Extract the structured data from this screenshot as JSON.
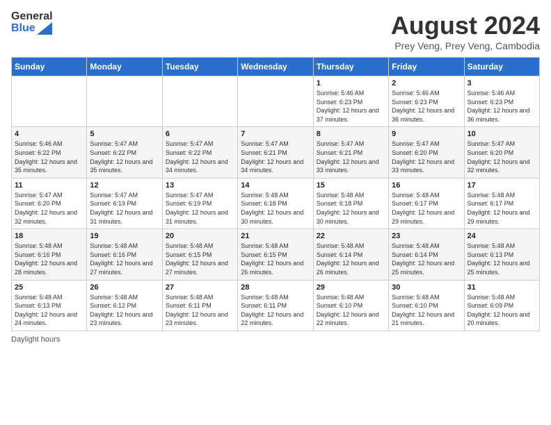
{
  "header": {
    "logo_general": "General",
    "logo_blue": "Blue",
    "title": "August 2024",
    "subtitle": "Prey Veng, Prey Veng, Cambodia"
  },
  "calendar": {
    "days_of_week": [
      "Sunday",
      "Monday",
      "Tuesday",
      "Wednesday",
      "Thursday",
      "Friday",
      "Saturday"
    ],
    "weeks": [
      [
        {
          "day": "",
          "info": ""
        },
        {
          "day": "",
          "info": ""
        },
        {
          "day": "",
          "info": ""
        },
        {
          "day": "",
          "info": ""
        },
        {
          "day": "1",
          "info": "Sunrise: 5:46 AM\nSunset: 6:23 PM\nDaylight: 12 hours and 37 minutes."
        },
        {
          "day": "2",
          "info": "Sunrise: 5:46 AM\nSunset: 6:23 PM\nDaylight: 12 hours and 36 minutes."
        },
        {
          "day": "3",
          "info": "Sunrise: 5:46 AM\nSunset: 6:23 PM\nDaylight: 12 hours and 36 minutes."
        }
      ],
      [
        {
          "day": "4",
          "info": "Sunrise: 5:46 AM\nSunset: 6:22 PM\nDaylight: 12 hours and 35 minutes."
        },
        {
          "day": "5",
          "info": "Sunrise: 5:47 AM\nSunset: 6:22 PM\nDaylight: 12 hours and 35 minutes."
        },
        {
          "day": "6",
          "info": "Sunrise: 5:47 AM\nSunset: 6:22 PM\nDaylight: 12 hours and 34 minutes."
        },
        {
          "day": "7",
          "info": "Sunrise: 5:47 AM\nSunset: 6:21 PM\nDaylight: 12 hours and 34 minutes."
        },
        {
          "day": "8",
          "info": "Sunrise: 5:47 AM\nSunset: 6:21 PM\nDaylight: 12 hours and 33 minutes."
        },
        {
          "day": "9",
          "info": "Sunrise: 5:47 AM\nSunset: 6:20 PM\nDaylight: 12 hours and 33 minutes."
        },
        {
          "day": "10",
          "info": "Sunrise: 5:47 AM\nSunset: 6:20 PM\nDaylight: 12 hours and 32 minutes."
        }
      ],
      [
        {
          "day": "11",
          "info": "Sunrise: 5:47 AM\nSunset: 6:20 PM\nDaylight: 12 hours and 32 minutes."
        },
        {
          "day": "12",
          "info": "Sunrise: 5:47 AM\nSunset: 6:19 PM\nDaylight: 12 hours and 31 minutes."
        },
        {
          "day": "13",
          "info": "Sunrise: 5:47 AM\nSunset: 6:19 PM\nDaylight: 12 hours and 31 minutes."
        },
        {
          "day": "14",
          "info": "Sunrise: 5:48 AM\nSunset: 6:18 PM\nDaylight: 12 hours and 30 minutes."
        },
        {
          "day": "15",
          "info": "Sunrise: 5:48 AM\nSunset: 6:18 PM\nDaylight: 12 hours and 30 minutes."
        },
        {
          "day": "16",
          "info": "Sunrise: 5:48 AM\nSunset: 6:17 PM\nDaylight: 12 hours and 29 minutes."
        },
        {
          "day": "17",
          "info": "Sunrise: 5:48 AM\nSunset: 6:17 PM\nDaylight: 12 hours and 29 minutes."
        }
      ],
      [
        {
          "day": "18",
          "info": "Sunrise: 5:48 AM\nSunset: 6:16 PM\nDaylight: 12 hours and 28 minutes."
        },
        {
          "day": "19",
          "info": "Sunrise: 5:48 AM\nSunset: 6:16 PM\nDaylight: 12 hours and 27 minutes."
        },
        {
          "day": "20",
          "info": "Sunrise: 5:48 AM\nSunset: 6:15 PM\nDaylight: 12 hours and 27 minutes."
        },
        {
          "day": "21",
          "info": "Sunrise: 5:48 AM\nSunset: 6:15 PM\nDaylight: 12 hours and 26 minutes."
        },
        {
          "day": "22",
          "info": "Sunrise: 5:48 AM\nSunset: 6:14 PM\nDaylight: 12 hours and 26 minutes."
        },
        {
          "day": "23",
          "info": "Sunrise: 5:48 AM\nSunset: 6:14 PM\nDaylight: 12 hours and 25 minutes."
        },
        {
          "day": "24",
          "info": "Sunrise: 5:48 AM\nSunset: 6:13 PM\nDaylight: 12 hours and 25 minutes."
        }
      ],
      [
        {
          "day": "25",
          "info": "Sunrise: 5:48 AM\nSunset: 6:13 PM\nDaylight: 12 hours and 24 minutes."
        },
        {
          "day": "26",
          "info": "Sunrise: 5:48 AM\nSunset: 6:12 PM\nDaylight: 12 hours and 23 minutes."
        },
        {
          "day": "27",
          "info": "Sunrise: 5:48 AM\nSunset: 6:11 PM\nDaylight: 12 hours and 23 minutes."
        },
        {
          "day": "28",
          "info": "Sunrise: 5:48 AM\nSunset: 6:11 PM\nDaylight: 12 hours and 22 minutes."
        },
        {
          "day": "29",
          "info": "Sunrise: 5:48 AM\nSunset: 6:10 PM\nDaylight: 12 hours and 22 minutes."
        },
        {
          "day": "30",
          "info": "Sunrise: 5:48 AM\nSunset: 6:10 PM\nDaylight: 12 hours and 21 minutes."
        },
        {
          "day": "31",
          "info": "Sunrise: 5:48 AM\nSunset: 6:09 PM\nDaylight: 12 hours and 20 minutes."
        }
      ]
    ]
  },
  "footer": {
    "daylight_note": "Daylight hours"
  }
}
